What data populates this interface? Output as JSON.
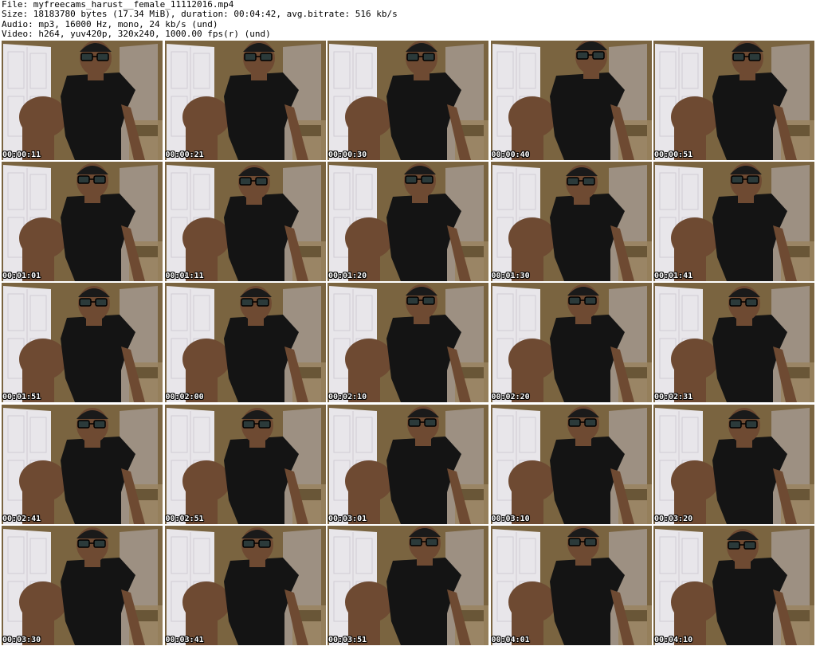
{
  "header": {
    "file_line": "File: myfreecams_harust__female_11112016.mp4",
    "size_line": "Size: 18183780 bytes (17.34 MiB), duration: 00:04:42, avg.bitrate: 516 kb/s",
    "audio_line": "Audio: mp3, 16000 Hz, mono, 24 kb/s (und)",
    "video_line": "Video: h264, yuv420p, 320x240, 1000.00 fps(r) (und)"
  },
  "thumbnails": [
    {
      "timestamp": "00:00:11"
    },
    {
      "timestamp": "00:00:21"
    },
    {
      "timestamp": "00:00:30"
    },
    {
      "timestamp": "00:00:40"
    },
    {
      "timestamp": "00:00:51"
    },
    {
      "timestamp": "00:01:01"
    },
    {
      "timestamp": "00:01:11"
    },
    {
      "timestamp": "00:01:20"
    },
    {
      "timestamp": "00:01:30"
    },
    {
      "timestamp": "00:01:41"
    },
    {
      "timestamp": "00:01:51"
    },
    {
      "timestamp": "00:02:00"
    },
    {
      "timestamp": "00:02:10"
    },
    {
      "timestamp": "00:02:20"
    },
    {
      "timestamp": "00:02:31"
    },
    {
      "timestamp": "00:02:41"
    },
    {
      "timestamp": "00:02:51"
    },
    {
      "timestamp": "00:03:01"
    },
    {
      "timestamp": "00:03:10"
    },
    {
      "timestamp": "00:03:20"
    },
    {
      "timestamp": "00:03:30"
    },
    {
      "timestamp": "00:03:41"
    },
    {
      "timestamp": "00:03:51"
    },
    {
      "timestamp": "00:04:01"
    },
    {
      "timestamp": "00:04:10"
    }
  ],
  "colors": {
    "wall": "#7a6440",
    "door": "#e8e6ea",
    "shirt": "#141414",
    "skin": "#6e4a32",
    "floor": "#9a8460",
    "text": "#ffffff"
  }
}
